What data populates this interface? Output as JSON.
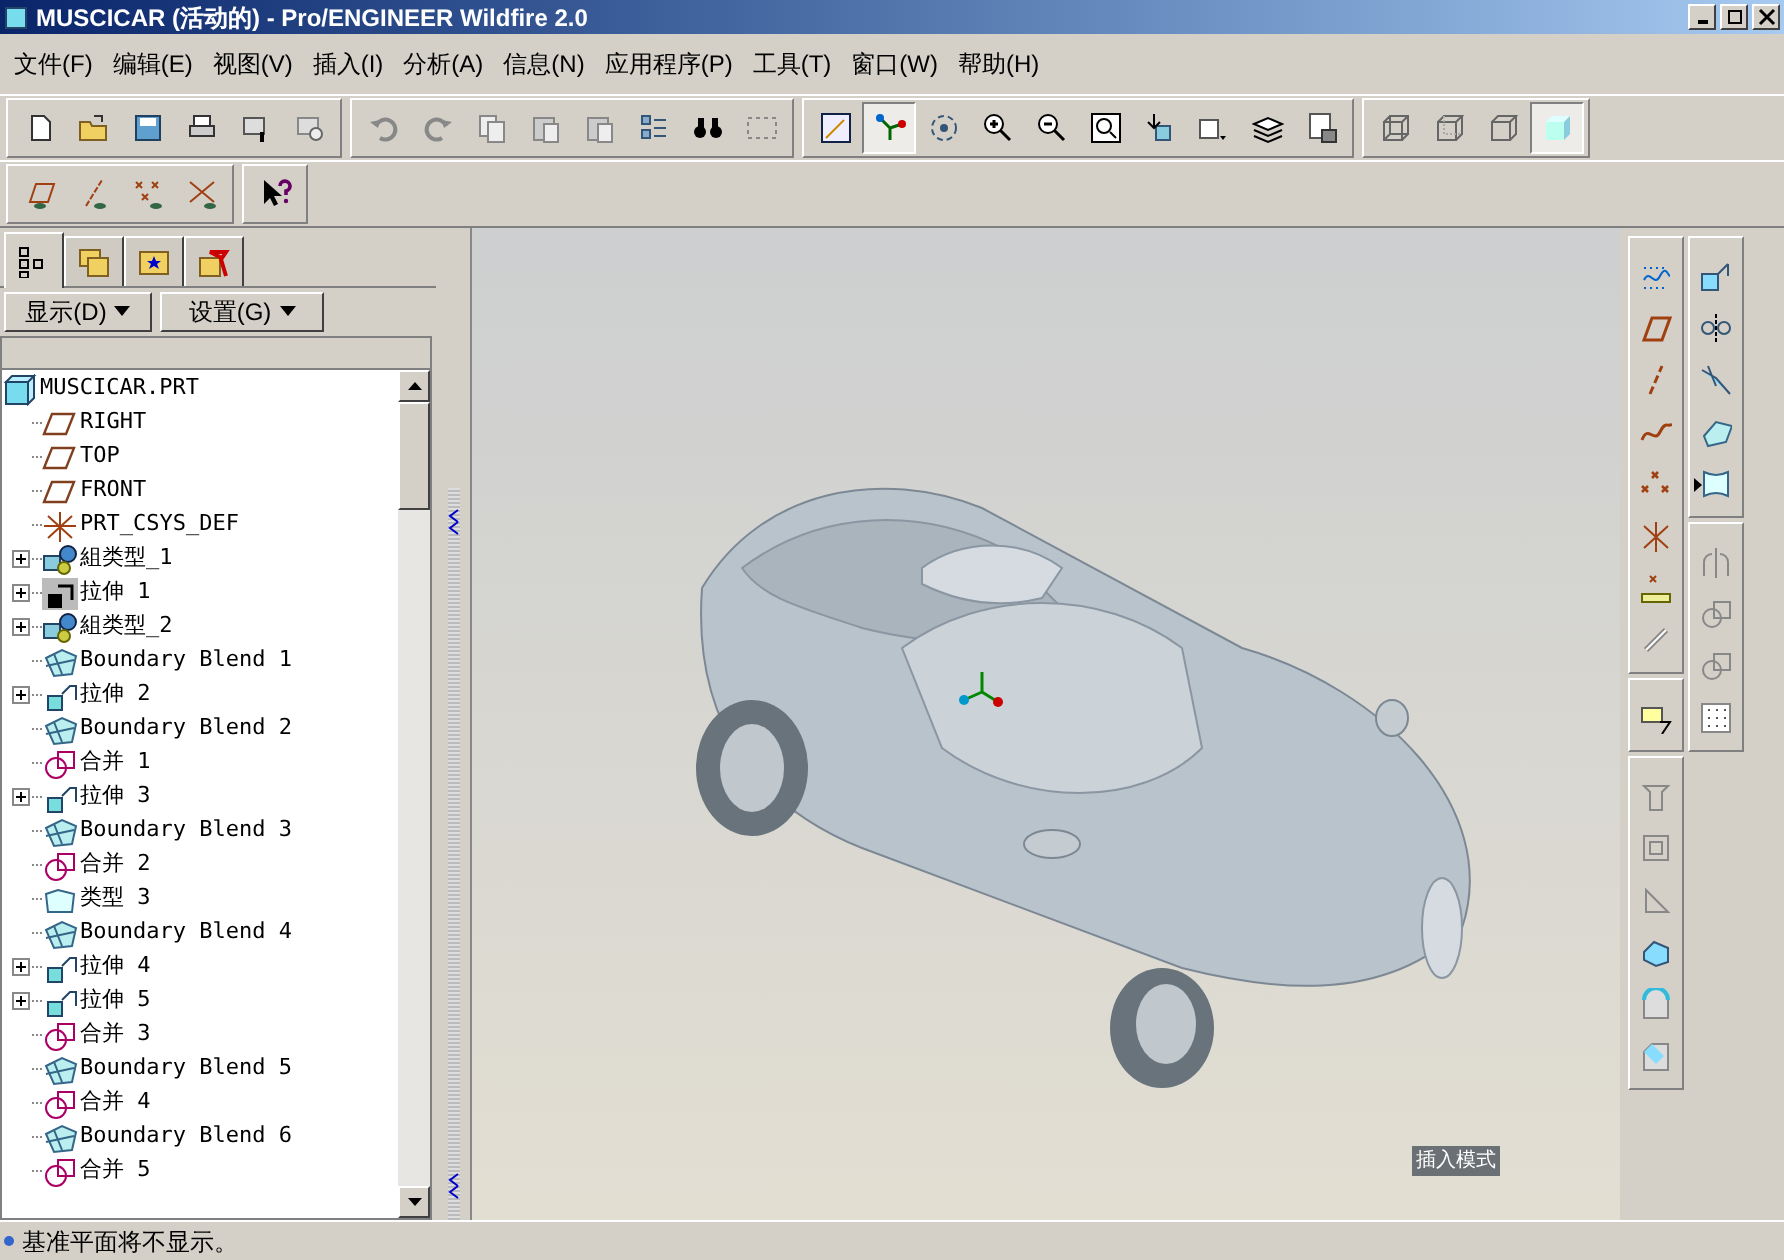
{
  "window": {
    "title": "MUSCICAR (活动的) - Pro/ENGINEER Wildfire 2.0"
  },
  "menu": [
    "文件(F)",
    "编辑(E)",
    "视图(V)",
    "插入(I)",
    "分析(A)",
    "信息(N)",
    "应用程序(P)",
    "工具(T)",
    "窗口(W)",
    "帮助(H)"
  ],
  "toolbar_rows": [
    [
      {
        "kind": "new",
        "pressed": false
      },
      {
        "kind": "open",
        "pressed": false
      },
      {
        "kind": "save",
        "pressed": false
      },
      {
        "kind": "print",
        "pressed": false
      },
      {
        "kind": "close",
        "pressed": false
      },
      {
        "kind": "erase",
        "pressed": false
      },
      {
        "kind": "sep"
      },
      {
        "kind": "undo",
        "pressed": false
      },
      {
        "kind": "redo",
        "pressed": false
      },
      {
        "kind": "copy",
        "pressed": false
      },
      {
        "kind": "paste",
        "pressed": false
      },
      {
        "kind": "paste",
        "pressed": false
      },
      {
        "kind": "regenerate",
        "pressed": false
      },
      {
        "kind": "find",
        "pressed": false
      },
      {
        "kind": "select",
        "pressed": false
      },
      {
        "kind": "sep"
      },
      {
        "kind": "plane",
        "pressed": false
      },
      {
        "kind": "csys",
        "pressed": true
      },
      {
        "kind": "spin",
        "pressed": false
      },
      {
        "kind": "zoomin",
        "pressed": false
      },
      {
        "kind": "zoomout",
        "pressed": false
      },
      {
        "kind": "refit",
        "pressed": false
      },
      {
        "kind": "reorient",
        "pressed": false
      },
      {
        "kind": "views",
        "pressed": false
      },
      {
        "kind": "layers",
        "pressed": false
      },
      {
        "kind": "setup",
        "pressed": false
      },
      {
        "kind": "sep"
      },
      {
        "kind": "wire",
        "pressed": false
      },
      {
        "kind": "hidden",
        "pressed": false
      },
      {
        "kind": "nohidden",
        "pressed": false
      },
      {
        "kind": "shade",
        "pressed": true
      }
    ],
    [
      {
        "kind": "planedisp",
        "pressed": false
      },
      {
        "kind": "axisdisp",
        "pressed": false
      },
      {
        "kind": "pointdisp",
        "pressed": false
      },
      {
        "kind": "csysdisp",
        "pressed": false
      },
      {
        "kind": "sep"
      },
      {
        "kind": "help",
        "pressed": false
      }
    ]
  ],
  "panel": {
    "tabs": [
      {
        "kind": "tree",
        "selected": true
      },
      {
        "kind": "folder",
        "selected": false
      },
      {
        "kind": "favorites",
        "selected": false
      },
      {
        "kind": "tools",
        "selected": false
      }
    ],
    "buttons": [
      "显示(D)",
      "设置(G)"
    ],
    "tree": {
      "root": "MUSCICAR.PRT",
      "items": [
        {
          "label": "RIGHT",
          "kind": "plane",
          "collapsed": false
        },
        {
          "label": "TOP",
          "kind": "plane",
          "collapsed": false
        },
        {
          "label": "FRONT",
          "kind": "plane",
          "collapsed": false
        },
        {
          "label": "PRT_CSYS_DEF",
          "kind": "csys",
          "collapsed": false
        },
        {
          "label": "組类型_1",
          "kind": "group",
          "collapsed": true
        },
        {
          "label": "拉伸 1",
          "kind": "extrude_dark",
          "collapsed": true
        },
        {
          "label": "組类型_2",
          "kind": "group",
          "collapsed": true
        },
        {
          "label": "Boundary Blend 1",
          "kind": "blend",
          "collapsed": false
        },
        {
          "label": "拉伸 2",
          "kind": "extrude",
          "collapsed": true
        },
        {
          "label": "Boundary Blend 2",
          "kind": "blend",
          "collapsed": false
        },
        {
          "label": "合并 1",
          "kind": "merge",
          "collapsed": false
        },
        {
          "label": "拉伸 3",
          "kind": "extrude",
          "collapsed": true
        },
        {
          "label": "Boundary Blend 3",
          "kind": "blend",
          "collapsed": false
        },
        {
          "label": "合并 2",
          "kind": "merge",
          "collapsed": false
        },
        {
          "label": "类型 3",
          "kind": "surface",
          "collapsed": false
        },
        {
          "label": "Boundary Blend 4",
          "kind": "blend",
          "collapsed": false
        },
        {
          "label": "拉伸 4",
          "kind": "extrude",
          "collapsed": true
        },
        {
          "label": "拉伸 5",
          "kind": "extrude",
          "collapsed": true
        },
        {
          "label": "合并 3",
          "kind": "merge",
          "collapsed": false
        },
        {
          "label": "Boundary Blend 5",
          "kind": "blend",
          "collapsed": false
        },
        {
          "label": "合并 4",
          "kind": "merge",
          "collapsed": false
        },
        {
          "label": "Boundary Blend 6",
          "kind": "blend",
          "collapsed": false
        },
        {
          "label": "合并 5",
          "kind": "merge",
          "collapsed": false
        }
      ]
    }
  },
  "viewport": {
    "mode_text": "插入模式"
  },
  "status_bar": {
    "message": "基准平面将不显示。"
  }
}
